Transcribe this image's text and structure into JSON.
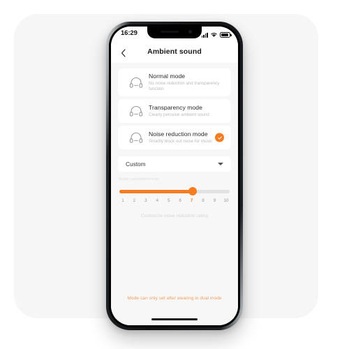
{
  "status_bar": {
    "time": "16:29",
    "signal_icon": "signal-bars-icon",
    "wifi_icon": "wifi-icon",
    "battery_icon": "battery-icon"
  },
  "nav": {
    "back_icon": "chevron-left-icon",
    "title": "Ambient sound"
  },
  "modes": [
    {
      "id": "normal",
      "icon": "headphones-icon",
      "title": "Normal mode",
      "subtitle": "No noise reduction and transparency function",
      "selected": false
    },
    {
      "id": "transparency",
      "icon": "headphones-icon",
      "title": "Transparency mode",
      "subtitle": "Clearly perceive ambient sound",
      "selected": false
    },
    {
      "id": "noise_reduction",
      "icon": "headphones-icon",
      "title": "Noise reduction mode",
      "subtitle": "Smartly block out noise for music",
      "selected": true,
      "check_icon": "check-icon"
    }
  ],
  "dropdown": {
    "value": "Custom",
    "chevron_icon": "chevron-down-icon",
    "options": [
      "Custom"
    ]
  },
  "slider": {
    "label": "Noise cancellation leve",
    "value": 7,
    "min": 1,
    "max": 10,
    "ticks": [
      "1",
      "2",
      "3",
      "4",
      "5",
      "6",
      "7",
      "8",
      "9",
      "10"
    ],
    "hint": "Customize noise reduction rating"
  },
  "footnote": "Mode can only set after wearing in dual mode",
  "colors": {
    "accent": "#f57c20",
    "footnote": "#f0a15e",
    "screen_bg": "#f7f7f7",
    "card_bg": "#ffffff",
    "backdrop": "#f6f6f6",
    "track": "#e2e2e2"
  }
}
